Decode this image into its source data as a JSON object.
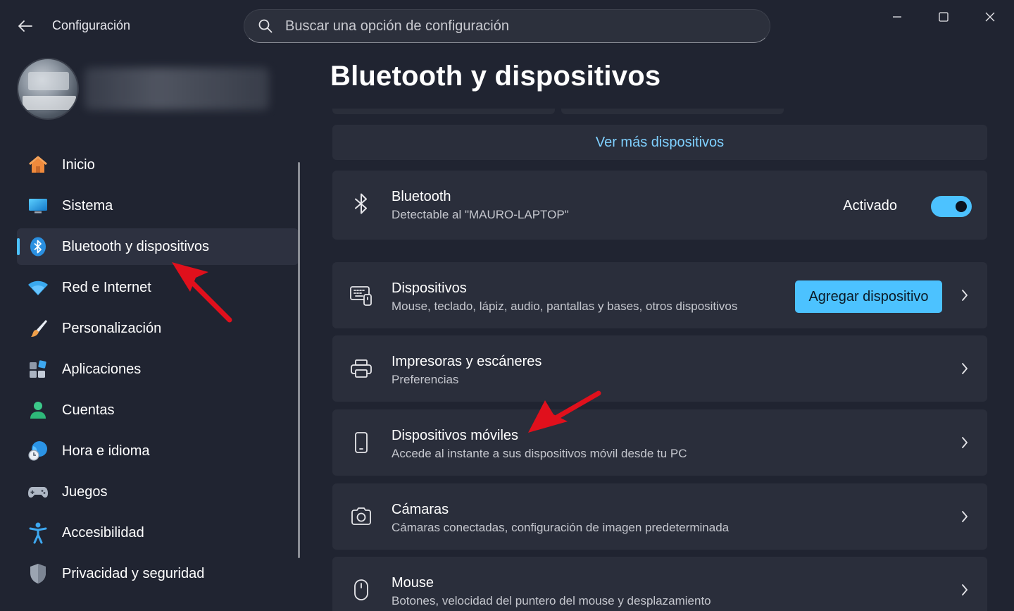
{
  "window": {
    "app_title": "Configuración",
    "search_placeholder": "Buscar una opción de configuración"
  },
  "sidebar": {
    "items": [
      {
        "label": "Inicio",
        "icon": "home-icon"
      },
      {
        "label": "Sistema",
        "icon": "monitor-icon"
      },
      {
        "label": "Bluetooth y dispositivos",
        "icon": "bluetooth-icon",
        "selected": true
      },
      {
        "label": "Red e Internet",
        "icon": "wifi-icon"
      },
      {
        "label": "Personalización",
        "icon": "brush-icon"
      },
      {
        "label": "Aplicaciones",
        "icon": "apps-icon"
      },
      {
        "label": "Cuentas",
        "icon": "person-icon"
      },
      {
        "label": "Hora e idioma",
        "icon": "globe-clock-icon"
      },
      {
        "label": "Juegos",
        "icon": "gamepad-icon"
      },
      {
        "label": "Accesibilidad",
        "icon": "accessibility-icon"
      },
      {
        "label": "Privacidad y seguridad",
        "icon": "shield-icon"
      }
    ]
  },
  "main": {
    "title": "Bluetooth y dispositivos",
    "see_more": "Ver más dispositivos",
    "bluetooth": {
      "title": "Bluetooth",
      "subtitle": "Detectable al \"MAURO-LAPTOP\"",
      "state_label": "Activado",
      "enabled": true
    },
    "rows": [
      {
        "title": "Dispositivos",
        "subtitle": "Mouse, teclado, lápiz, audio, pantallas y bases, otros dispositivos",
        "icon": "devices-icon",
        "button": "Agregar dispositivo"
      },
      {
        "title": "Impresoras y escáneres",
        "subtitle": "Preferencias",
        "icon": "printer-icon"
      },
      {
        "title": "Dispositivos móviles",
        "subtitle": "Accede al instante a sus dispositivos móvil desde tu PC",
        "icon": "phone-icon"
      },
      {
        "title": "Cámaras",
        "subtitle": "Cámaras conectadas, configuración de imagen predeterminada",
        "icon": "camera-icon"
      },
      {
        "title": "Mouse",
        "subtitle": "Botones, velocidad del puntero del mouse y desplazamiento",
        "icon": "mouse-icon"
      }
    ]
  },
  "colors": {
    "background": "#202431",
    "card": "#2a2e3b",
    "accent": "#4cc2ff",
    "annotation_arrow": "#e0101c"
  }
}
